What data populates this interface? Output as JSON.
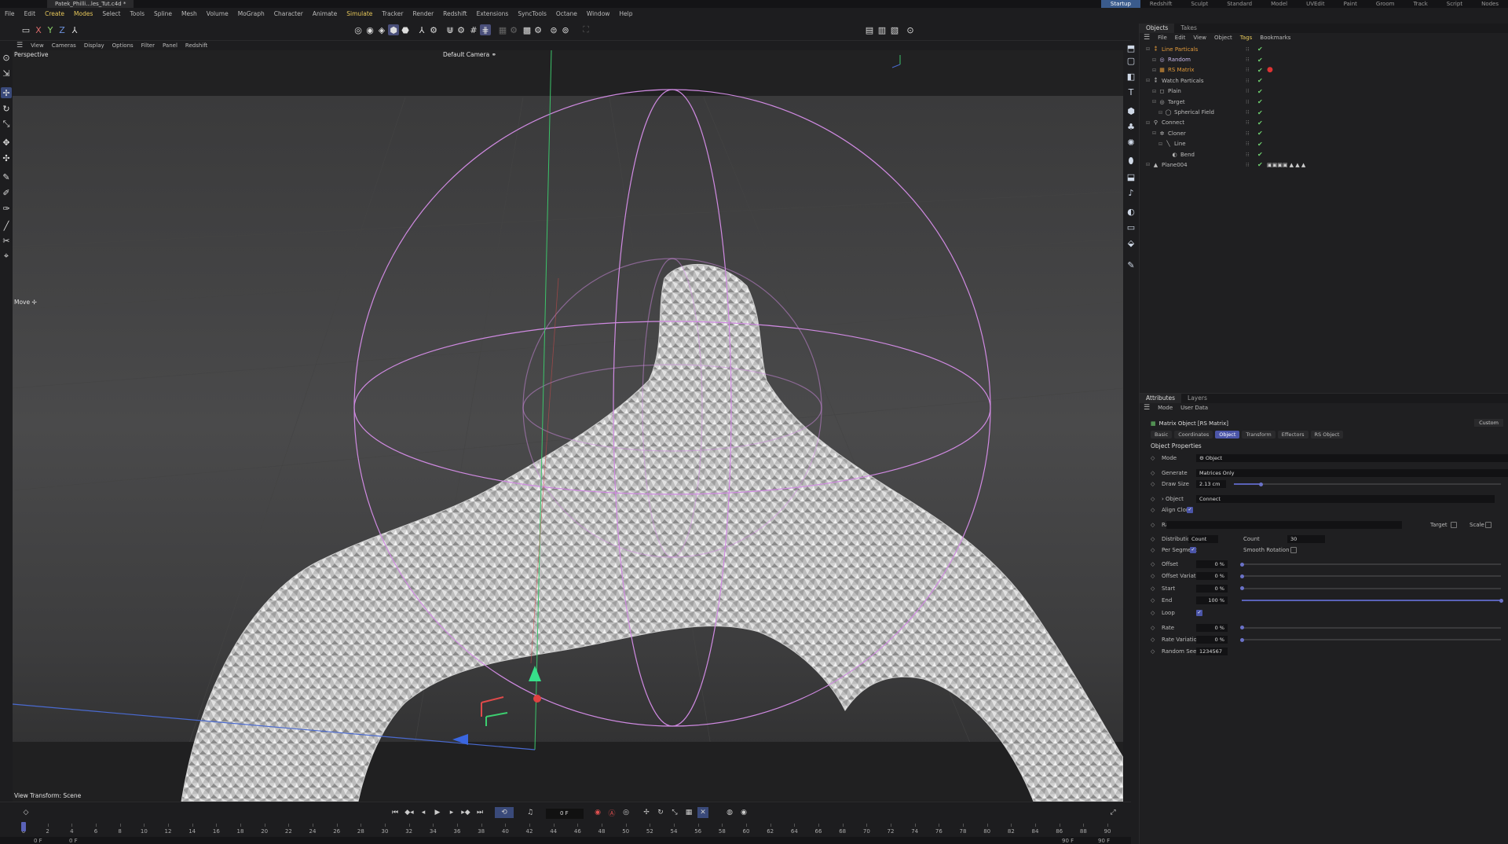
{
  "titlebar": {
    "file_tab": "Patek_Philli...les_Tut.c4d *"
  },
  "layouts": [
    "Startup",
    "Redshift",
    "Sculpt",
    "Standard",
    "Model",
    "UVEdit",
    "Paint",
    "Groom",
    "Track",
    "Script",
    "Nodes"
  ],
  "menus": [
    {
      "label": "File",
      "hl": false
    },
    {
      "label": "Edit",
      "hl": false
    },
    {
      "label": "Create",
      "hl": true
    },
    {
      "label": "Modes",
      "hl": true
    },
    {
      "label": "Select",
      "hl": false
    },
    {
      "label": "Tools",
      "hl": false
    },
    {
      "label": "Spline",
      "hl": false
    },
    {
      "label": "Mesh",
      "hl": false
    },
    {
      "label": "Volume",
      "hl": false
    },
    {
      "label": "MoGraph",
      "hl": false
    },
    {
      "label": "Character",
      "hl": false
    },
    {
      "label": "Animate",
      "hl": false
    },
    {
      "label": "Simulate",
      "hl": true
    },
    {
      "label": "Tracker",
      "hl": false
    },
    {
      "label": "Render",
      "hl": false
    },
    {
      "label": "Redshift",
      "hl": false
    },
    {
      "label": "Extensions",
      "hl": false
    },
    {
      "label": "SyncTools",
      "hl": false
    },
    {
      "label": "Octane",
      "hl": false
    },
    {
      "label": "Window",
      "hl": false
    },
    {
      "label": "Help",
      "hl": false
    }
  ],
  "axes": {
    "x": "X",
    "y": "Y",
    "z": "Z"
  },
  "viewport_menu": [
    "View",
    "Cameras",
    "Display",
    "Options",
    "Filter",
    "Panel",
    "Redshift"
  ],
  "viewport": {
    "view_name": "Perspective",
    "camera": "Default Camera ⚭",
    "tool_label": "Move ✢",
    "view_transform": "View Transform: Scene"
  },
  "colors": {
    "accent": "#4b55a8",
    "active_layout": "#3a5b8c",
    "highlight_menu": "#e7c85a",
    "check_green": "#6fd16f",
    "field_magenta": "#c48ad6"
  },
  "timeline": {
    "current_frame": "0 F",
    "ticks": [
      "0",
      "2",
      "4",
      "6",
      "8",
      "10",
      "12",
      "14",
      "16",
      "18",
      "20",
      "22",
      "24",
      "26",
      "28",
      "30",
      "32",
      "34",
      "36",
      "38",
      "40",
      "42",
      "44",
      "46",
      "48",
      "50",
      "52",
      "54",
      "56",
      "58",
      "60",
      "62",
      "64",
      "66",
      "68",
      "70",
      "72",
      "74",
      "76",
      "78",
      "80",
      "82",
      "84",
      "86",
      "88",
      "90"
    ],
    "range_start": "0 F",
    "range_start2": "0 F",
    "range_end": "90 F",
    "range_end2": "90 F"
  },
  "objects_panel": {
    "tabs": [
      "Objects",
      "Takes"
    ],
    "menu": [
      {
        "label": "File",
        "hl": false
      },
      {
        "label": "Edit",
        "hl": false
      },
      {
        "label": "View",
        "hl": false
      },
      {
        "label": "Object",
        "hl": false
      },
      {
        "label": "Tags",
        "hl": true
      },
      {
        "label": "Bookmarks",
        "hl": false
      }
    ],
    "items": [
      {
        "name": "Line Particals",
        "indent": 0,
        "color": "#e29a3a",
        "icon": "⁑",
        "tag": ""
      },
      {
        "name": "Random",
        "indent": 1,
        "color": "#c7b7e8",
        "icon": "◎",
        "tag": ""
      },
      {
        "name": "RS Matrix",
        "indent": 1,
        "color": "#e29a3a",
        "icon": "▦",
        "tag": "●"
      },
      {
        "name": "Watch Particals",
        "indent": 0,
        "color": "#bbbbbb",
        "icon": "⁑",
        "tag": ""
      },
      {
        "name": "Plain",
        "indent": 1,
        "color": "#bbbbbb",
        "icon": "◻",
        "tag": ""
      },
      {
        "name": "Target",
        "indent": 1,
        "color": "#bbbbbb",
        "icon": "◎",
        "tag": ""
      },
      {
        "name": "Spherical Field",
        "indent": 2,
        "color": "#bbbbbb",
        "icon": "◯",
        "tag": ""
      },
      {
        "name": "Connect",
        "indent": 0,
        "color": "#bbbbbb",
        "icon": "⚲",
        "tag": ""
      },
      {
        "name": "Cloner",
        "indent": 1,
        "color": "#bbbbbb",
        "icon": "✲",
        "tag": ""
      },
      {
        "name": "Line",
        "indent": 2,
        "color": "#bbbbbb",
        "icon": "╲",
        "tag": ""
      },
      {
        "name": "Bend",
        "indent": 3,
        "color": "#bbbbbb",
        "icon": "◐",
        "tag": ""
      },
      {
        "name": "Plane004",
        "indent": 0,
        "color": "#bbbbbb",
        "icon": "▲",
        "tag": "▣▣▣▣ ▲ ▲ ▲"
      }
    ]
  },
  "attributes": {
    "tabs": [
      "Attributes",
      "Layers"
    ],
    "menu": [
      "Mode",
      "User Data"
    ],
    "object_title": "Matrix Object [RS Matrix]",
    "preset": "Custom",
    "subtabs": [
      "Basic",
      "Coordinates",
      "Object",
      "Transform",
      "Effectors",
      "RS Object"
    ],
    "active_subtab": "Object",
    "section": "Object Properties",
    "fields": {
      "mode": {
        "label": "Mode",
        "value": "⚙ Object"
      },
      "generate": {
        "label": "Generate",
        "value": "Matrices Only"
      },
      "draw_size": {
        "label": "Draw Size",
        "value": "2.13 cm",
        "fraction": 0.1
      },
      "object": {
        "label": "› Object",
        "value": "Connect"
      },
      "align_clone": {
        "label": "Align Clone",
        "checked": true
      },
      "rail": {
        "label": "Rail",
        "value": ""
      },
      "target": {
        "label": "Target",
        "checked": false
      },
      "scale": {
        "label": "Scale",
        "checked": false
      },
      "distribution": {
        "label": "Distribution",
        "value": "Count"
      },
      "count": {
        "label": "Count",
        "value": "30"
      },
      "per_segment": {
        "label": "Per Segment",
        "checked": true
      },
      "smooth_rotation": {
        "label": "Smooth Rotation",
        "checked": false
      },
      "offset": {
        "label": "Offset",
        "value": "0 %",
        "fraction": 0
      },
      "offset_variation": {
        "label": "Offset Variation",
        "value": "0 %",
        "fraction": 0
      },
      "start": {
        "label": "Start",
        "value": "0 %",
        "fraction": 0
      },
      "end": {
        "label": "End",
        "value": "100 %",
        "fraction": 1
      },
      "loop": {
        "label": "Loop",
        "checked": true
      },
      "rate": {
        "label": "Rate",
        "value": "0 %",
        "fraction": 0
      },
      "rate_variation": {
        "label": "Rate Variation",
        "value": "0 %",
        "fraction": 0
      },
      "random_seed": {
        "label": "Random Seed",
        "value": "1234567"
      }
    }
  }
}
